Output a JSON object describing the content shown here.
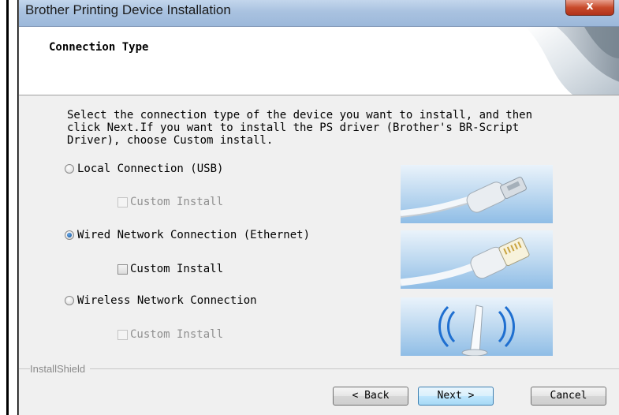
{
  "window": {
    "title": "Brother Printing Device Installation",
    "close_symbol": "x"
  },
  "header": {
    "title": "Connection Type"
  },
  "instructions": "Select the connection type of the device you want to install, and then\nclick Next.If you want to install the PS driver (Brother's BR-Script\nDriver), choose Custom install.",
  "options": [
    {
      "label": "Local Connection (USB)",
      "selected": false,
      "custom_install": {
        "label": "Custom Install",
        "enabled": false,
        "checked": false
      }
    },
    {
      "label": "Wired Network Connection (Ethernet)",
      "selected": true,
      "custom_install": {
        "label": "Custom Install",
        "enabled": true,
        "checked": false
      }
    },
    {
      "label": "Wireless Network Connection",
      "selected": false,
      "custom_install": {
        "label": "Custom Install",
        "enabled": false,
        "checked": false
      }
    }
  ],
  "footer": {
    "brand": "InstallShield",
    "back_label": "< Back",
    "next_label": "Next >",
    "cancel_label": "Cancel"
  },
  "colors": {
    "titlebar": "#a9c2e0",
    "close_button": "#c84b2c",
    "illustration_blue": "#8fbde6"
  }
}
